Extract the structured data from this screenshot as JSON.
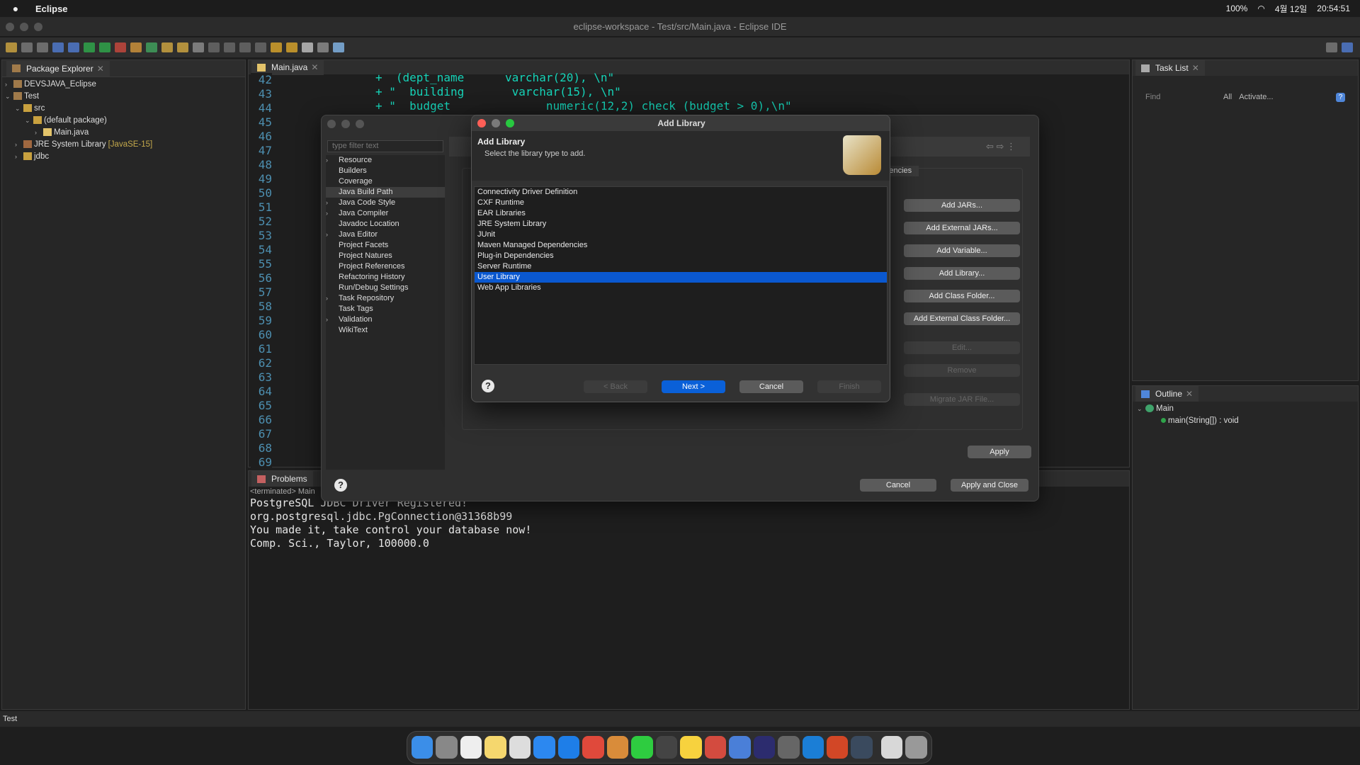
{
  "menubar": {
    "app_name": "Eclipse",
    "status_right": [
      "100%",
      "4월 12일",
      "20:54:51"
    ]
  },
  "window": {
    "title": "eclipse-workspace - Test/src/Main.java - Eclipse IDE"
  },
  "package_explorer": {
    "tab_label": "Package Explorer",
    "items": [
      {
        "label": "DEVSJAVA_Eclipse",
        "depth": 0,
        "caret": "›"
      },
      {
        "label": "Test",
        "depth": 0,
        "caret": "⌄"
      },
      {
        "label": "src",
        "depth": 1,
        "caret": "⌄"
      },
      {
        "label": "(default package)",
        "depth": 2,
        "caret": "⌄"
      },
      {
        "label": "Main.java",
        "depth": 3,
        "caret": "›"
      },
      {
        "label": "JRE System Library",
        "suffix": "[JavaSE-15]",
        "depth": 1,
        "caret": "›"
      },
      {
        "label": "jdbc",
        "depth": 1,
        "caret": "›"
      }
    ]
  },
  "editor": {
    "tab_label": "Main.java",
    "line_numbers": [
      "42",
      "43",
      "44",
      "45",
      "46",
      "47",
      "48",
      "49",
      "50",
      "51",
      "52",
      "53",
      "54",
      "55",
      "56",
      "57",
      "58",
      "59",
      "60",
      "61",
      "62",
      "63",
      "64",
      "65",
      "66",
      "67",
      "68",
      "69"
    ],
    "code_lines": [
      "+  (dept_name      varchar(20), \\n\"",
      "+ \"  building       varchar(15), \\n\"",
      "+ \"  budget              numeric(12,2) check (budget > 0),\\n\""
    ]
  },
  "task_list": {
    "tab_label": "Task List",
    "find_placeholder": "Find",
    "filter_all": "All",
    "filter_activate": "Activate..."
  },
  "outline": {
    "tab_label": "Outline",
    "class_name": "Main",
    "method": "main(String[]) : void"
  },
  "problems": {
    "tab_label": "Problems",
    "terminated_label": "<terminated> Main"
  },
  "console": {
    "lines": [
      "PostgreSQL JDBC Driver Registered!",
      "org.postgresql.jdbc.PgConnection@31368b99",
      "You made it, take control your database now!",
      "Comp. Sci., Taylor, 100000.0"
    ]
  },
  "properties_dialog": {
    "filter_placeholder": "type filter text",
    "nav": [
      {
        "label": "Resource",
        "caret": true
      },
      {
        "label": "Builders",
        "caret": false
      },
      {
        "label": "Coverage",
        "caret": false
      },
      {
        "label": "Java Build Path",
        "caret": false,
        "selected": true
      },
      {
        "label": "Java Code Style",
        "caret": true
      },
      {
        "label": "Java Compiler",
        "caret": true
      },
      {
        "label": "Javadoc Location",
        "caret": false
      },
      {
        "label": "Java Editor",
        "caret": true
      },
      {
        "label": "Project Facets",
        "caret": false
      },
      {
        "label": "Project Natures",
        "caret": false
      },
      {
        "label": "Project References",
        "caret": false
      },
      {
        "label": "Refactoring History",
        "caret": false
      },
      {
        "label": "Run/Debug Settings",
        "caret": false
      },
      {
        "label": "Task Repository",
        "caret": true
      },
      {
        "label": "Task Tags",
        "caret": false
      },
      {
        "label": "Validation",
        "caret": true
      },
      {
        "label": "WikiText",
        "caret": false
      }
    ],
    "page_title_partial": "Ja",
    "tab_partial": "endencies",
    "side_buttons": [
      "Add JARs...",
      "Add External JARs...",
      "Add Variable...",
      "Add Library...",
      "Add Class Folder...",
      "Add External Class Folder...",
      "Edit...",
      "Remove",
      "Migrate JAR File..."
    ],
    "apply_label": "Apply",
    "cancel_label": "Cancel",
    "apply_close_label": "Apply and Close"
  },
  "add_library": {
    "window_title": "Add Library",
    "heading": "Add Library",
    "subtitle": "Select the library type to add.",
    "types": [
      "Connectivity Driver Definition",
      "CXF Runtime",
      "EAR Libraries",
      "JRE System Library",
      "JUnit",
      "Maven Managed Dependencies",
      "Plug-in Dependencies",
      "Server Runtime",
      "User Library",
      "Web App Libraries"
    ],
    "selected": "User Library",
    "back_label": "< Back",
    "next_label": "Next >",
    "cancel_label": "Cancel",
    "finish_label": "Finish"
  },
  "statusbar": {
    "text": "Test"
  },
  "colors": {
    "selection": "#0a58d0",
    "primary_button": "#0a60d8",
    "code": "#16d3b8"
  }
}
